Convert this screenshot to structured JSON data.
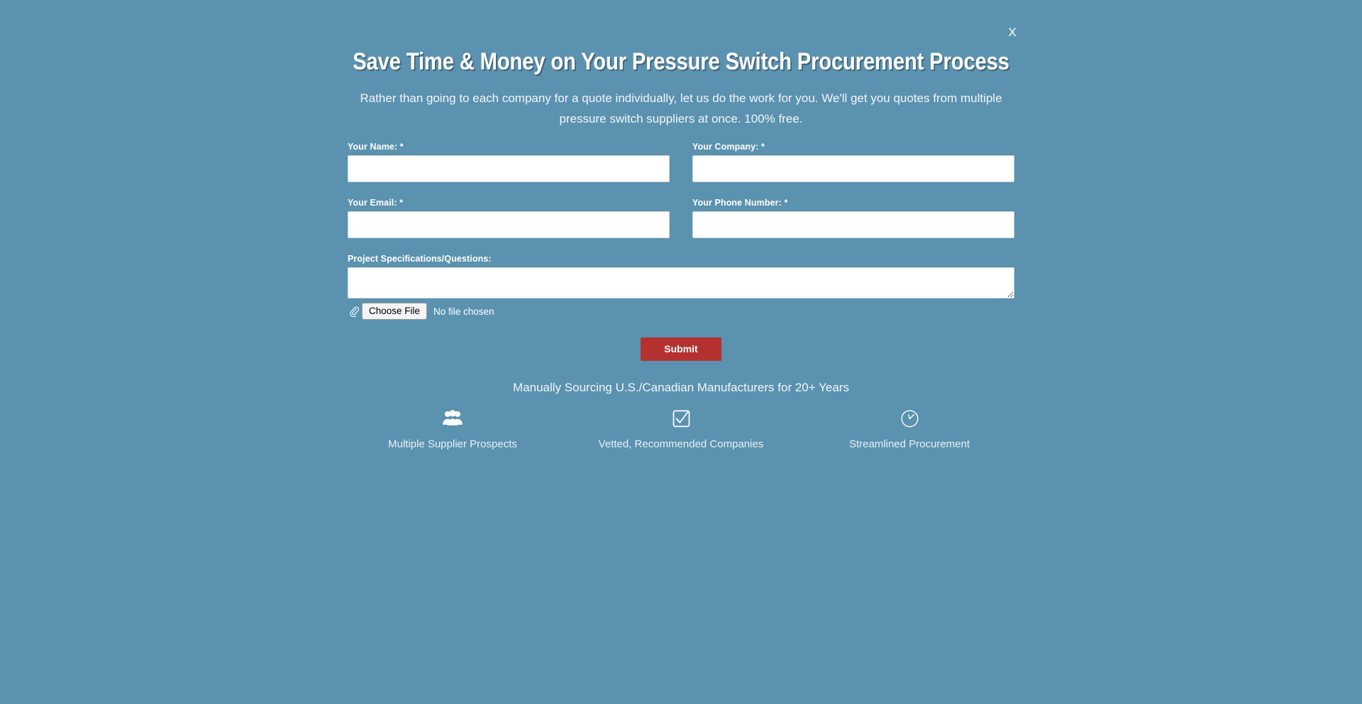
{
  "modal": {
    "close_label": "X",
    "title": "Save Time & Money on Your Pressure Switch Procurement Process",
    "subtitle": "Rather than going to each company for a quote individually, let us do the work for you. We'll get you quotes from multiple pressure switch suppliers at once. 100% free.",
    "accent_color": "#b4312f",
    "background_color": "#5b92b0"
  },
  "form": {
    "fields": [
      {
        "label": "Your Name: *",
        "value": "",
        "placeholder": "",
        "name": "your-name-input"
      },
      {
        "label": "Your Company: *",
        "value": "",
        "placeholder": "",
        "name": "your-company-input"
      },
      {
        "label": "Your Email: *",
        "value": "",
        "placeholder": "",
        "name": "your-email-input"
      },
      {
        "label": "Your Phone Number: *",
        "value": "",
        "placeholder": "",
        "name": "your-phone-number-input"
      }
    ],
    "textarea": {
      "label": "Project Specifications/Questions:",
      "value": "",
      "placeholder": ""
    },
    "file_upload": {
      "icon": "paperclip-icon",
      "button_label": "Choose File",
      "status_text": "No file chosen"
    },
    "submit_label": "Submit"
  },
  "footer": {
    "tagline": "Manually Sourcing U.S./Canadian Manufacturers for 20+ Years",
    "features": [
      {
        "icon": "users-group-icon",
        "label": "Multiple Supplier Prospects"
      },
      {
        "icon": "check-square-icon",
        "label": "Vetted, Recommended Companies"
      },
      {
        "icon": "clock-icon",
        "label": "Streamlined Procurement"
      }
    ]
  }
}
